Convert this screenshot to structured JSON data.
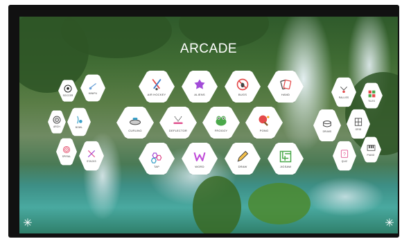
{
  "app": {
    "title": "ARCADE"
  },
  "colors": {
    "accent_pink": "#e0528f",
    "accent_purple": "#a24bd8",
    "accent_green": "#4aa84a",
    "accent_red": "#e44a4a"
  },
  "games_left": [
    {
      "id": "soccer",
      "label": "SOCCER",
      "icon": "soccer-ball-icon"
    },
    {
      "id": "mini",
      "label": "MINIPU",
      "icon": "mini-golf-icon"
    },
    {
      "id": "archery",
      "label": "ARCH",
      "icon": "target-icon"
    },
    {
      "id": "bowling",
      "label": "BOWL",
      "icon": "bowling-icon"
    },
    {
      "id": "spiral",
      "label": "SPIRAL",
      "icon": "spiral-icon"
    },
    {
      "id": "stacks",
      "label": "STACKS",
      "icon": "stacks-icon"
    }
  ],
  "games_main": [
    {
      "id": "air-hockey",
      "label": "AIR HOCKEY",
      "icon": "air-hockey-icon"
    },
    {
      "id": "aliens",
      "label": "ALIENS",
      "icon": "alien-icon"
    },
    {
      "id": "bugs",
      "label": "BUGS",
      "icon": "bug-icon"
    },
    {
      "id": "hand",
      "label": "HAND",
      "icon": "hand-cards-icon"
    },
    {
      "id": "curling",
      "label": "CURLING",
      "icon": "curling-stone-icon"
    },
    {
      "id": "deflector",
      "label": "DEFLECTOR",
      "icon": "deflector-icon"
    },
    {
      "id": "froggy",
      "label": "FROGGY",
      "icon": "frog-icon"
    },
    {
      "id": "pong",
      "label": "PONG",
      "icon": "ping-pong-icon"
    },
    {
      "id": "tap",
      "label": "TAP",
      "icon": "hexagons-icon"
    },
    {
      "id": "word",
      "label": "WORD",
      "icon": "letter-w-icon"
    },
    {
      "id": "draw",
      "label": "DRAW",
      "icon": "pencil-icon"
    },
    {
      "id": "jigsaw",
      "label": "JIGSAW",
      "icon": "maze-icon"
    }
  ],
  "games_right": [
    {
      "id": "rally",
      "label": "RALLIES",
      "icon": "shuttlecock-icon"
    },
    {
      "id": "tiles",
      "label": "TILES",
      "icon": "tiles-icon"
    },
    {
      "id": "drums",
      "label": "DRUMS",
      "icon": "drum-icon"
    },
    {
      "id": "grid",
      "label": "GRID",
      "icon": "grid-icon"
    },
    {
      "id": "quiz",
      "label": "QUIZ",
      "icon": "quiz-icon"
    },
    {
      "id": "piano",
      "label": "PIANO",
      "icon": "piano-icon"
    }
  ],
  "corners": {
    "left_icon": "asterisk-icon",
    "right_icon": "asterisk-icon",
    "glyph": "✳"
  }
}
